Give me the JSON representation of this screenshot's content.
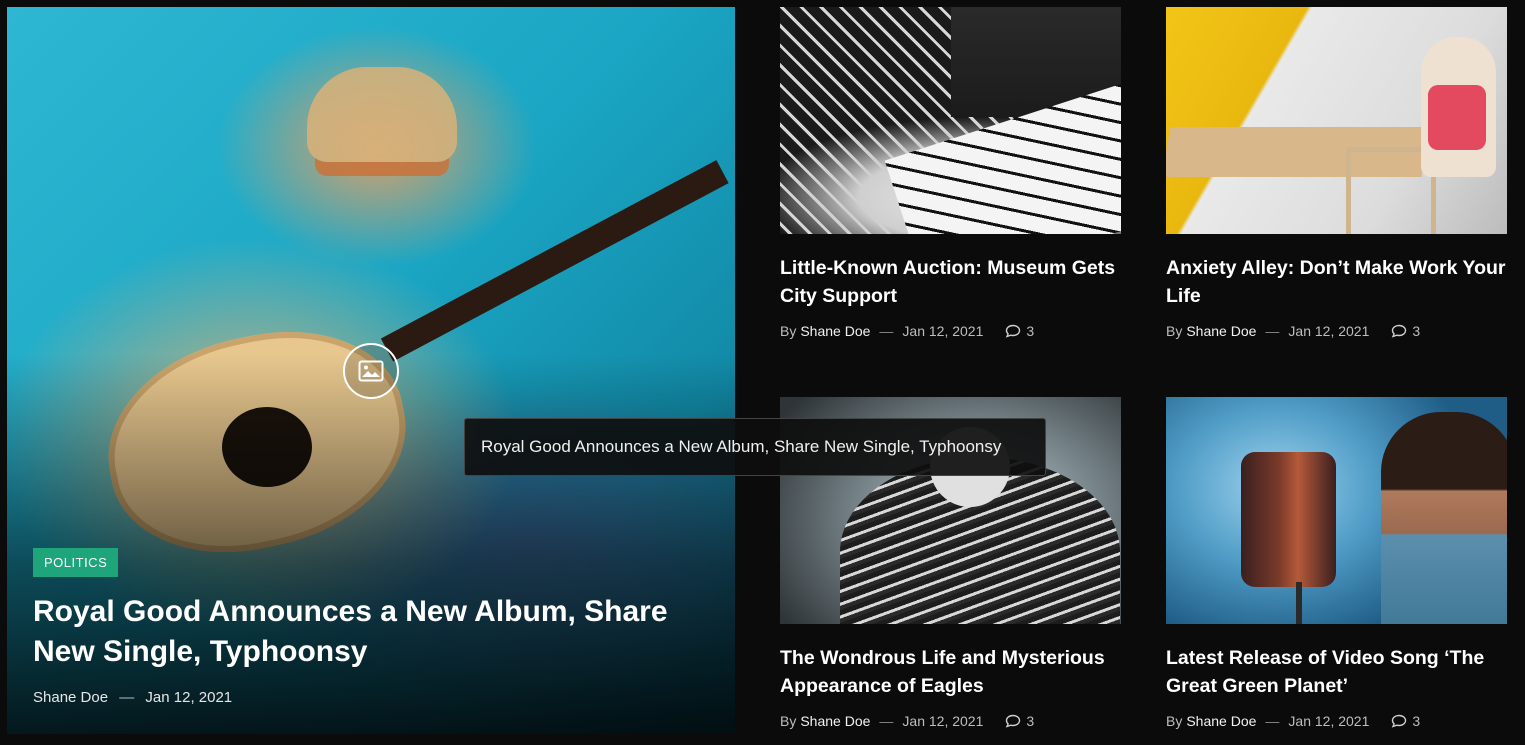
{
  "featured": {
    "category": "POLITICS",
    "title": "Royal Good Announces a New Album, Share New Single, Typhoonsy",
    "author": "Shane Doe",
    "date": "Jan 12, 2021",
    "image_icon": "image-icon",
    "tooltip": "Royal Good Announces a New Album, Share New Single, Typhoonsy"
  },
  "posts": [
    {
      "title": "Little-Known Auction: Museum Gets City Support",
      "by": "By",
      "author": "Shane Doe",
      "date": "Jan 12, 2021",
      "comments": "3"
    },
    {
      "title": "Anxiety Alley: Don’t Make Work Your Life",
      "by": "By",
      "author": "Shane Doe",
      "date": "Jan 12, 2021",
      "comments": "3"
    },
    {
      "title": "The Wondrous Life and Mysterious Appearance of Eagles",
      "by": "By",
      "author": "Shane Doe",
      "date": "Jan 12, 2021",
      "comments": "3"
    },
    {
      "title": "Latest Release of Video Song ‘The Great Green Planet’",
      "by": "By",
      "author": "Shane Doe",
      "date": "Jan 12, 2021",
      "comments": "3"
    }
  ],
  "meta_separator": "—",
  "colors": {
    "background": "#0b0b0b",
    "badge": "#1ea67a",
    "text": "#ffffff"
  }
}
